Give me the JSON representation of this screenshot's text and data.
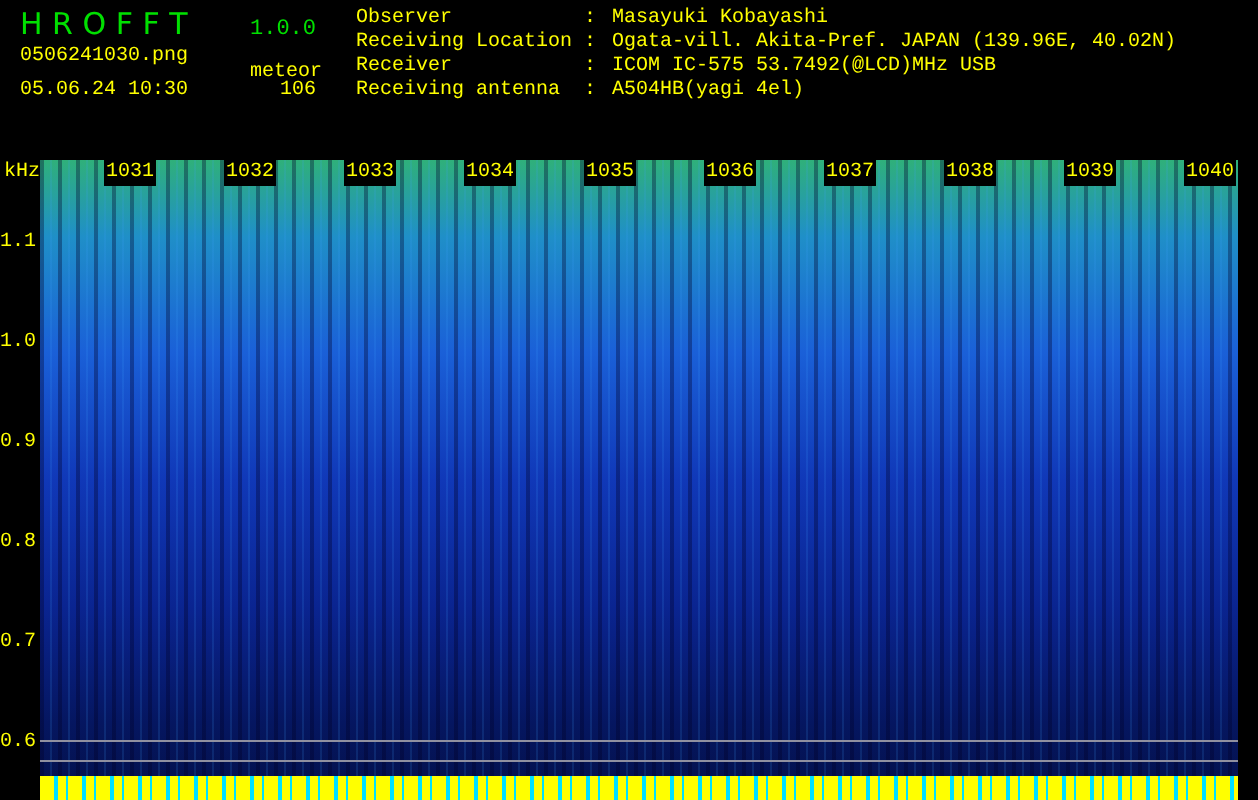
{
  "app": {
    "title": "H R O F F T",
    "version": "1.0.0"
  },
  "file": {
    "name": "0506241030.png",
    "datetime": "05.06.24 10:30",
    "mode": "meteor",
    "count": "106"
  },
  "info": [
    {
      "label": "Observer",
      "separator": ":",
      "value": "Masayuki Kobayashi"
    },
    {
      "label": "Receiving Location",
      "separator": ":",
      "value": "Ogata-vill. Akita-Pref. JAPAN (139.96E, 40.02N)"
    },
    {
      "label": "Receiver",
      "separator": ":",
      "value": "ICOM IC-575 53.7492(@LCD)MHz USB"
    },
    {
      "label": "Receiving antenna",
      "separator": ":",
      "value": "A504HB(yagi 4el)"
    }
  ],
  "y_axis": {
    "unit": "kHz",
    "labels": [
      "1.1",
      "1.0",
      "0.9",
      "0.8",
      "0.7",
      "0.6"
    ]
  },
  "time_labels": [
    "1031",
    "1032",
    "1033",
    "1034",
    "1035",
    "1036",
    "1037",
    "1038",
    "1039",
    "1040"
  ]
}
